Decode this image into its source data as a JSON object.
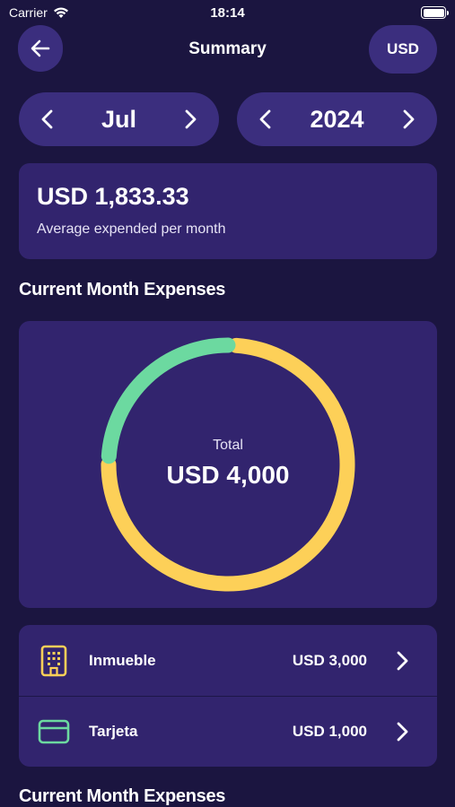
{
  "status": {
    "carrier": "Carrier",
    "time": "18:14"
  },
  "header": {
    "title": "Summary",
    "currency": "USD"
  },
  "month_selector": {
    "value": "Jul"
  },
  "year_selector": {
    "value": "2024"
  },
  "average": {
    "amount": "USD 1,833.33",
    "caption": "Average expended per month"
  },
  "sections": {
    "current_month_title": "Current Month Expenses",
    "second_title": "Current Month Expenses"
  },
  "chart_data": {
    "type": "pie",
    "total_label": "Total",
    "total_value": "USD 4,000",
    "categories": [
      "Inmueble",
      "Tarjeta"
    ],
    "values": [
      3000,
      1000
    ],
    "colors": [
      "#fdd058",
      "#6cd9a0"
    ]
  },
  "expenses": [
    {
      "name": "Inmueble",
      "amount": "USD 3,000",
      "icon": "building-icon",
      "color": "#fdd058"
    },
    {
      "name": "Tarjeta",
      "amount": "USD 1,000",
      "icon": "credit-card-icon",
      "color": "#6cd9a0"
    }
  ]
}
